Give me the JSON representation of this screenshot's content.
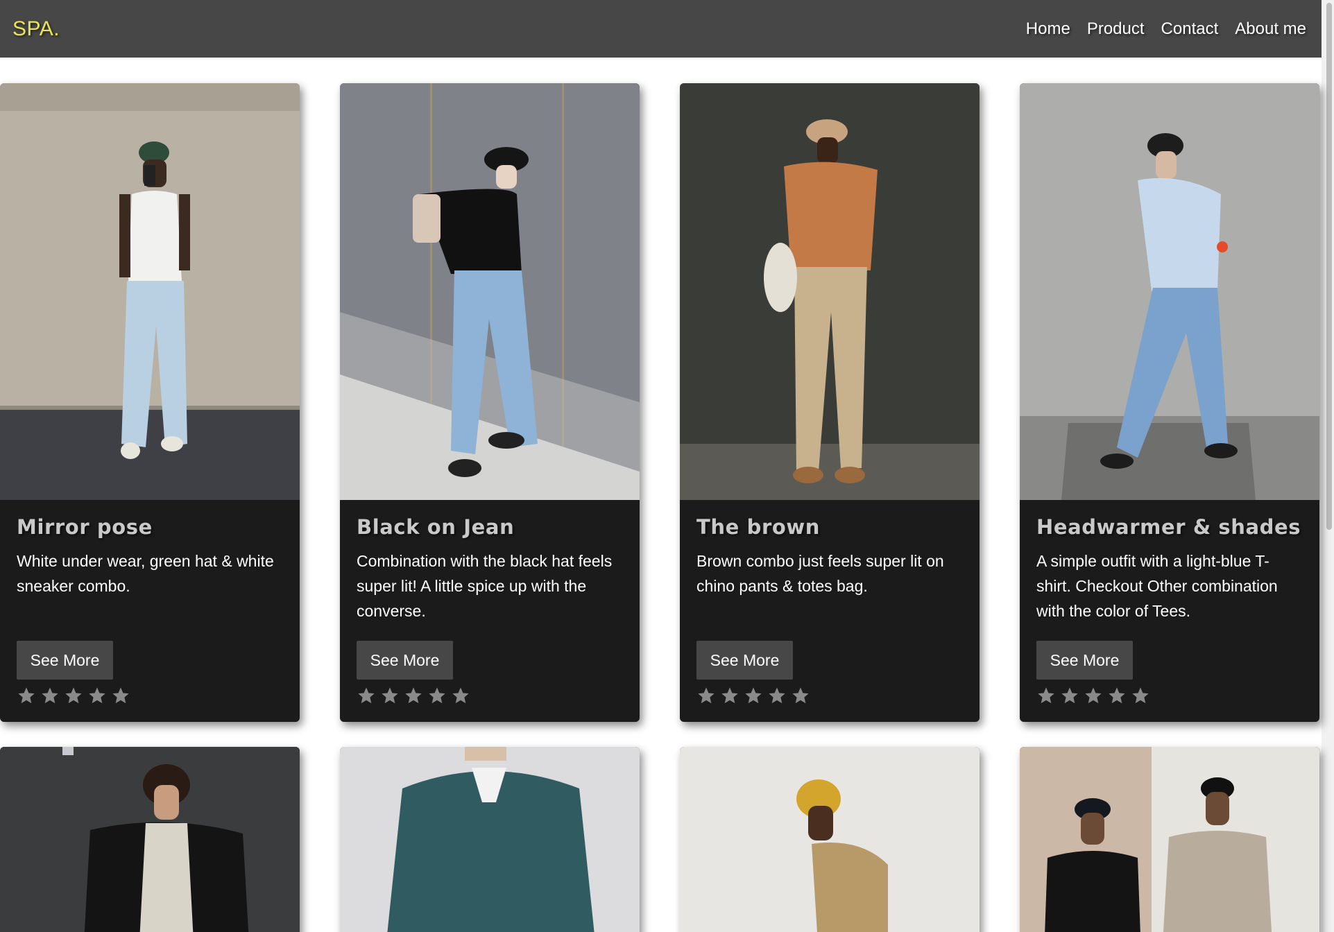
{
  "navbar": {
    "brand": "SPA.",
    "links": [
      "Home",
      "Product",
      "Contact",
      "About me"
    ]
  },
  "colors": {
    "navbar_bg": "#474747",
    "brand": "#e8e35a",
    "card_bg": "#1b1b1b",
    "button_bg": "#474747",
    "star": "#8a8a8a"
  },
  "cards": [
    {
      "title": "Mirror pose",
      "description": "White under wear, green hat & white sneaker combo.",
      "button": "See More",
      "stars": 5
    },
    {
      "title": "Black on Jean",
      "description": "Combination with the black hat feels super lit! A little spice up with the converse.",
      "button": "See More",
      "stars": 5
    },
    {
      "title": "The brown",
      "description": "Brown combo just feels super lit on chino pants & totes bag.",
      "button": "See More",
      "stars": 5
    },
    {
      "title": "Headwarmer & shades",
      "description": "A simple outfit with a light-blue T-shirt. Checkout Other combination with the color of Tees.",
      "button": "See More",
      "stars": 5
    }
  ],
  "row2_images": [
    "black-puffer-jacket-photo",
    "teal-polo-sweater-photo",
    "mustard-beanie-jacket-photo",
    "two-men-caps-photo"
  ]
}
